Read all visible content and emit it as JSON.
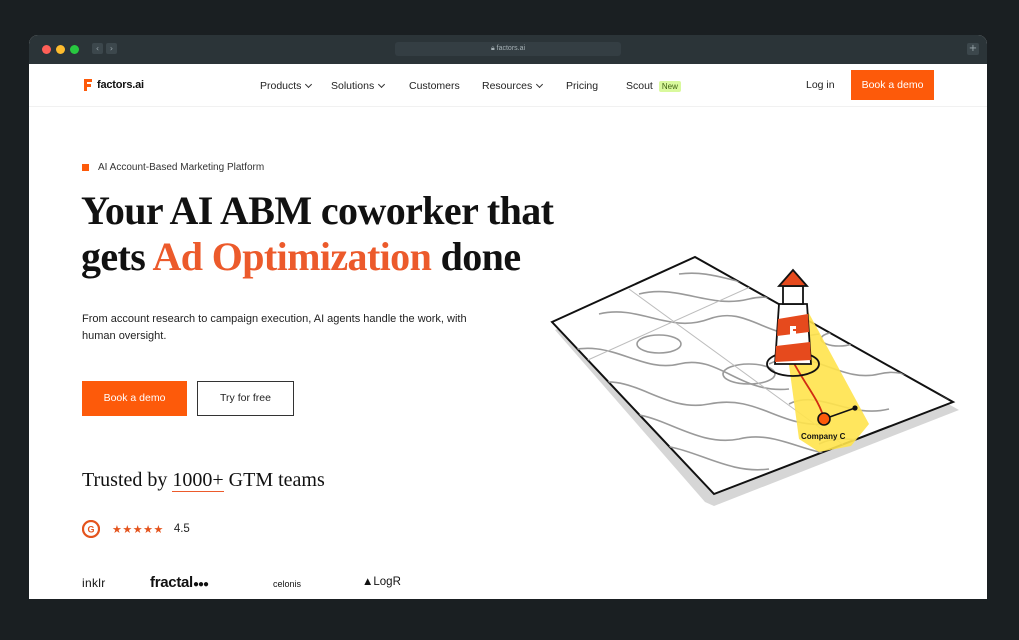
{
  "browser": {
    "url": "factors.ai",
    "back_glyph": "‹",
    "forward_glyph": "›",
    "new_tab_glyph": "+"
  },
  "header": {
    "logo_text": "factors.ai",
    "nav": [
      {
        "label": "Products",
        "has_dropdown": true
      },
      {
        "label": "Solutions",
        "has_dropdown": true
      },
      {
        "label": "Customers",
        "has_dropdown": false
      },
      {
        "label": "Resources",
        "has_dropdown": true
      },
      {
        "label": "Pricing",
        "has_dropdown": false
      },
      {
        "label": "Scout",
        "badge": "New"
      }
    ],
    "login": "Log in",
    "cta": "Book a demo"
  },
  "hero": {
    "eyebrow": "AI Account-Based Marketing Platform",
    "headline_part1": "Your AI ABM coworker that gets ",
    "headline_accent": "Ad Optimization",
    "headline_part2": " done",
    "subtext": "From account research to campaign execution, AI agents handle the work, with human oversight.",
    "primary_button": "Book a demo",
    "secondary_button": "Try for free",
    "illustration_label": "Company C"
  },
  "social_proof": {
    "trusted_prefix": "Trusted by ",
    "trusted_number": "1000+",
    "trusted_suffix": " GTM teams",
    "stars": "★★★★★",
    "rating": "4.5",
    "logos": [
      "inklr",
      "fractal",
      "celonis",
      "LogR"
    ]
  },
  "colors": {
    "brand_orange": "#fd5a0a",
    "headline_accent": "#ec5a2b",
    "beam_yellow": "#ffe34d"
  },
  "icons": {
    "g2": "g2-logo-icon",
    "lighthouse": "lighthouse-icon"
  }
}
